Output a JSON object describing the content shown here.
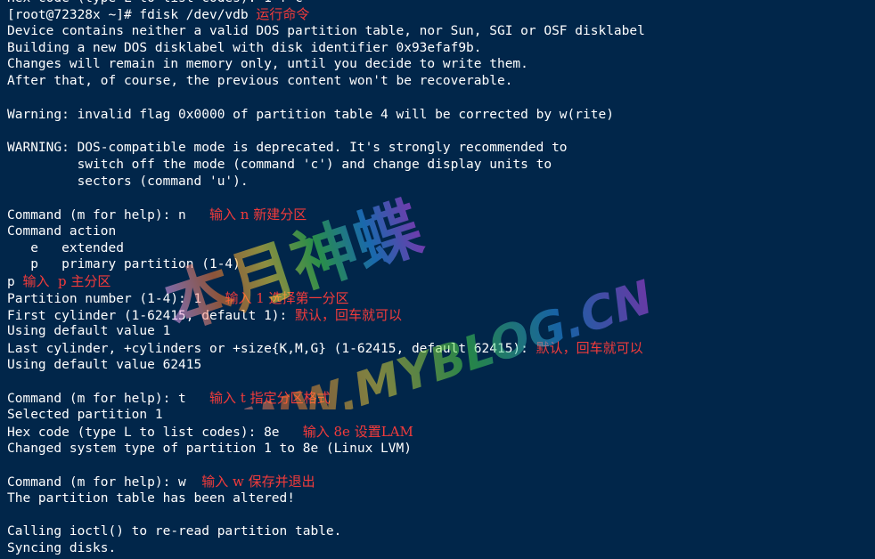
{
  "terminal": {
    "top_partial": "Hex code (type L to list codes): 1 f c",
    "lines": [
      {
        "text": "[root@72328x ~]# fdisk /dev/vdb",
        "note": "运行命令",
        "gap": " "
      },
      {
        "text": "Device contains neither a valid DOS partition table, nor Sun, SGI or OSF disklabel"
      },
      {
        "text": "Building a new DOS disklabel with disk identifier 0x93efaf9b."
      },
      {
        "text": "Changes will remain in memory only, until you decide to write them."
      },
      {
        "text": "After that, of course, the previous content won't be recoverable."
      },
      {
        "text": ""
      },
      {
        "text": "Warning: invalid flag 0x0000 of partition table 4 will be corrected by w(rite)"
      },
      {
        "text": ""
      },
      {
        "text": "WARNING: DOS-compatible mode is deprecated. It's strongly recommended to"
      },
      {
        "text": "         switch off the mode (command 'c') and change display units to"
      },
      {
        "text": "         sectors (command 'u')."
      },
      {
        "text": ""
      },
      {
        "text": "Command (m for help): n",
        "note": "输入 n 新建分区",
        "gap": "   "
      },
      {
        "text": "Command action"
      },
      {
        "text": "   e   extended"
      },
      {
        "text": "   p   primary partition (1-4)"
      },
      {
        "text": "p",
        "note": "输入  p 主分区",
        "gap": " "
      },
      {
        "text": "Partition number (1-4): 1",
        "note": "输入 1 选择第一分区",
        "gap": "   "
      },
      {
        "text": "First cylinder (1-62415, default 1):",
        "note": "默认，回车就可以",
        "gap": " "
      },
      {
        "text": "Using default value 1"
      },
      {
        "text": "Last cylinder, +cylinders or +size{K,M,G} (1-62415, default 62415):",
        "note": "默认，回车就可以",
        "gap": " "
      },
      {
        "text": "Using default value 62415"
      },
      {
        "text": ""
      },
      {
        "text": "Command (m for help): t",
        "note": "输入 t 指定分区格式",
        "gap": "   "
      },
      {
        "text": "Selected partition 1"
      },
      {
        "text": "Hex code (type L to list codes): 8e",
        "note": "输入 8e 设置LAM",
        "gap": "   "
      },
      {
        "text": "Changed system type of partition 1 to 8e (Linux LVM)"
      },
      {
        "text": ""
      },
      {
        "text": "Command (m for help): w",
        "note": "输入 w 保存并退出",
        "gap": "  "
      },
      {
        "text": "The partition table has been altered!"
      },
      {
        "text": ""
      },
      {
        "text": "Calling ioctl() to re-read partition table."
      },
      {
        "text": "Syncing disks."
      }
    ]
  },
  "watermark": {
    "cjk": "本月神蝶",
    "url": "WWW.MYBLOG.CN",
    "colors": [
      "#e6a5ff",
      "#ff7a2e",
      "#ffe23a",
      "#4be34b",
      "#2fa0ff",
      "#d14bff"
    ]
  }
}
